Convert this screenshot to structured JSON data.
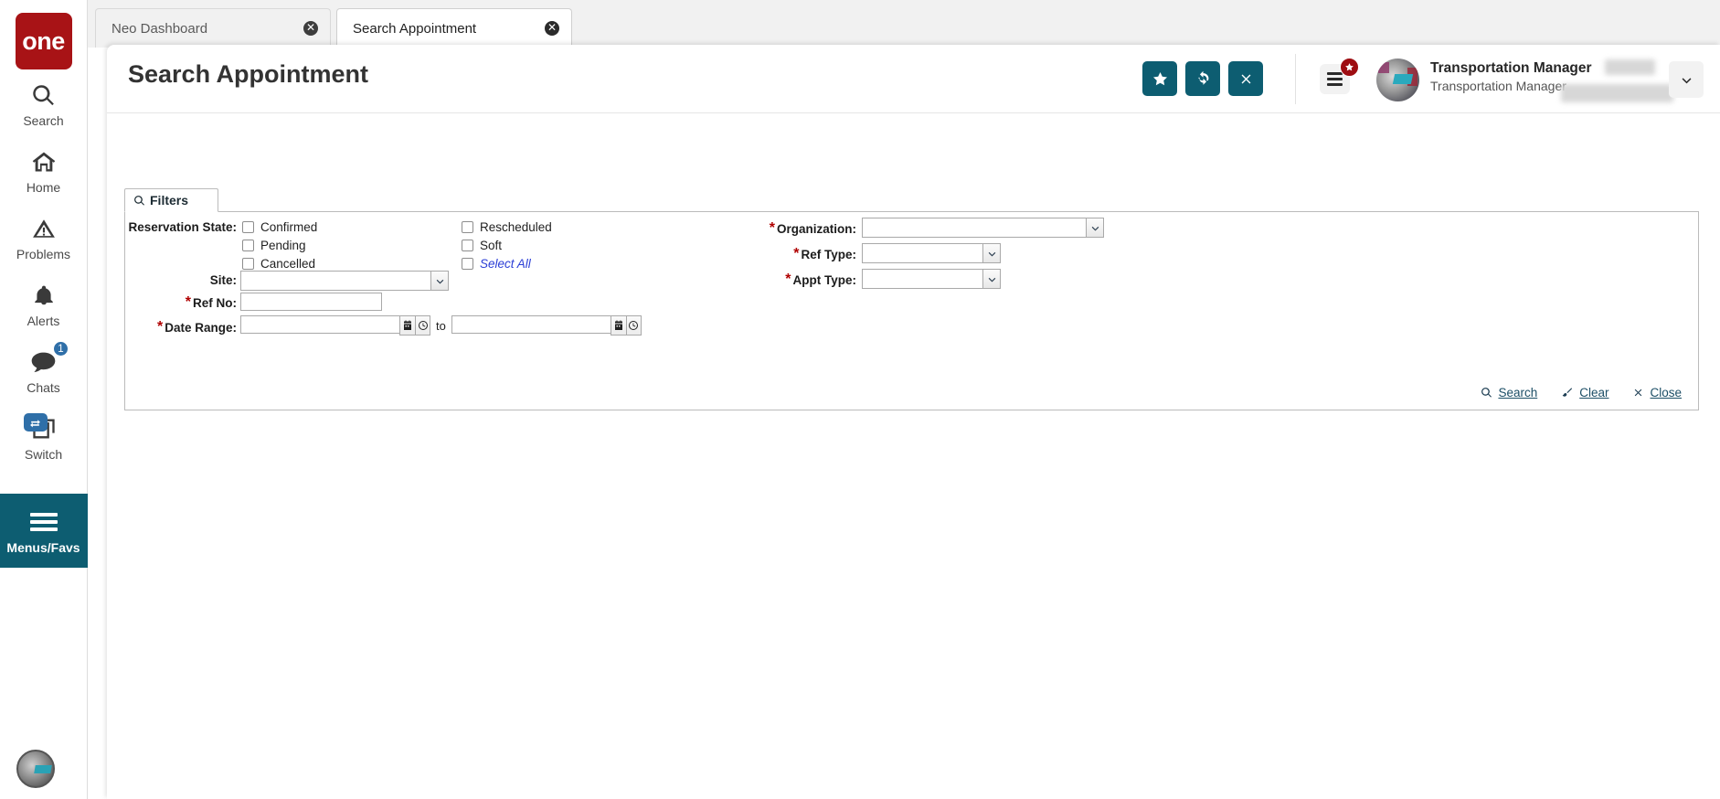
{
  "brand": {
    "logo_text": "one",
    "color": "#a81316"
  },
  "theme": {
    "accent": "#0d5d71",
    "required": "#b00000",
    "link": "#1c4e66",
    "badge_blue": "#2f6fa8",
    "badge_red": "#9e0d12"
  },
  "sidebar": {
    "items": [
      {
        "label": "Search",
        "icon": "search-icon"
      },
      {
        "label": "Home",
        "icon": "home-icon"
      },
      {
        "label": "Problems",
        "icon": "warning-triangle-icon"
      },
      {
        "label": "Alerts",
        "icon": "bell-icon"
      },
      {
        "label": "Chats",
        "icon": "chat-bubble-icon",
        "badge": "1"
      },
      {
        "label": "Switch",
        "icon": "switch-windows-icon"
      },
      {
        "label": "Menus/Favs",
        "icon": "hamburger-icon",
        "active": true
      }
    ],
    "avatar": "user-avatar"
  },
  "tabs": [
    {
      "label": "Neo Dashboard",
      "active": false,
      "close": "✕"
    },
    {
      "label": "Search Appointment",
      "active": true,
      "close": "✕"
    }
  ],
  "header": {
    "title": "Search Appointment",
    "actions": [
      {
        "name": "favorite-button",
        "icon": "star-icon"
      },
      {
        "name": "refresh-button",
        "icon": "refresh-icon"
      },
      {
        "name": "close-button",
        "icon": "close-x-icon"
      }
    ],
    "user": {
      "name": "Transportation Manager",
      "role": "Transportation Manager"
    }
  },
  "filters": {
    "tab_label": "Filters",
    "reservation_state": {
      "label": "Reservation State:",
      "options_left": [
        {
          "label": "Confirmed",
          "checked": false
        },
        {
          "label": "Pending",
          "checked": false
        },
        {
          "label": "Cancelled",
          "checked": false
        }
      ],
      "options_right": [
        {
          "label": "Rescheduled",
          "checked": false
        },
        {
          "label": "Soft",
          "checked": false
        },
        {
          "label": "Select All",
          "checked": false,
          "is_link": true
        }
      ]
    },
    "site": {
      "label": "Site:",
      "required": false,
      "value": ""
    },
    "ref_no": {
      "label": "Ref No:",
      "required": true,
      "value": ""
    },
    "date_range": {
      "label": "Date Range:",
      "required": true,
      "from_value": "",
      "to_value": "",
      "separator": "to"
    },
    "organization": {
      "label": "Organization:",
      "required": true,
      "value": ""
    },
    "ref_type": {
      "label": "Ref Type:",
      "required": true,
      "value": ""
    },
    "appt_type": {
      "label": "Appt Type:",
      "required": true,
      "value": ""
    },
    "actions": [
      {
        "label": "Search",
        "icon": "search-icon"
      },
      {
        "label": "Clear",
        "icon": "brush-icon"
      },
      {
        "label": "Close",
        "icon": "close-x-icon"
      }
    ]
  }
}
